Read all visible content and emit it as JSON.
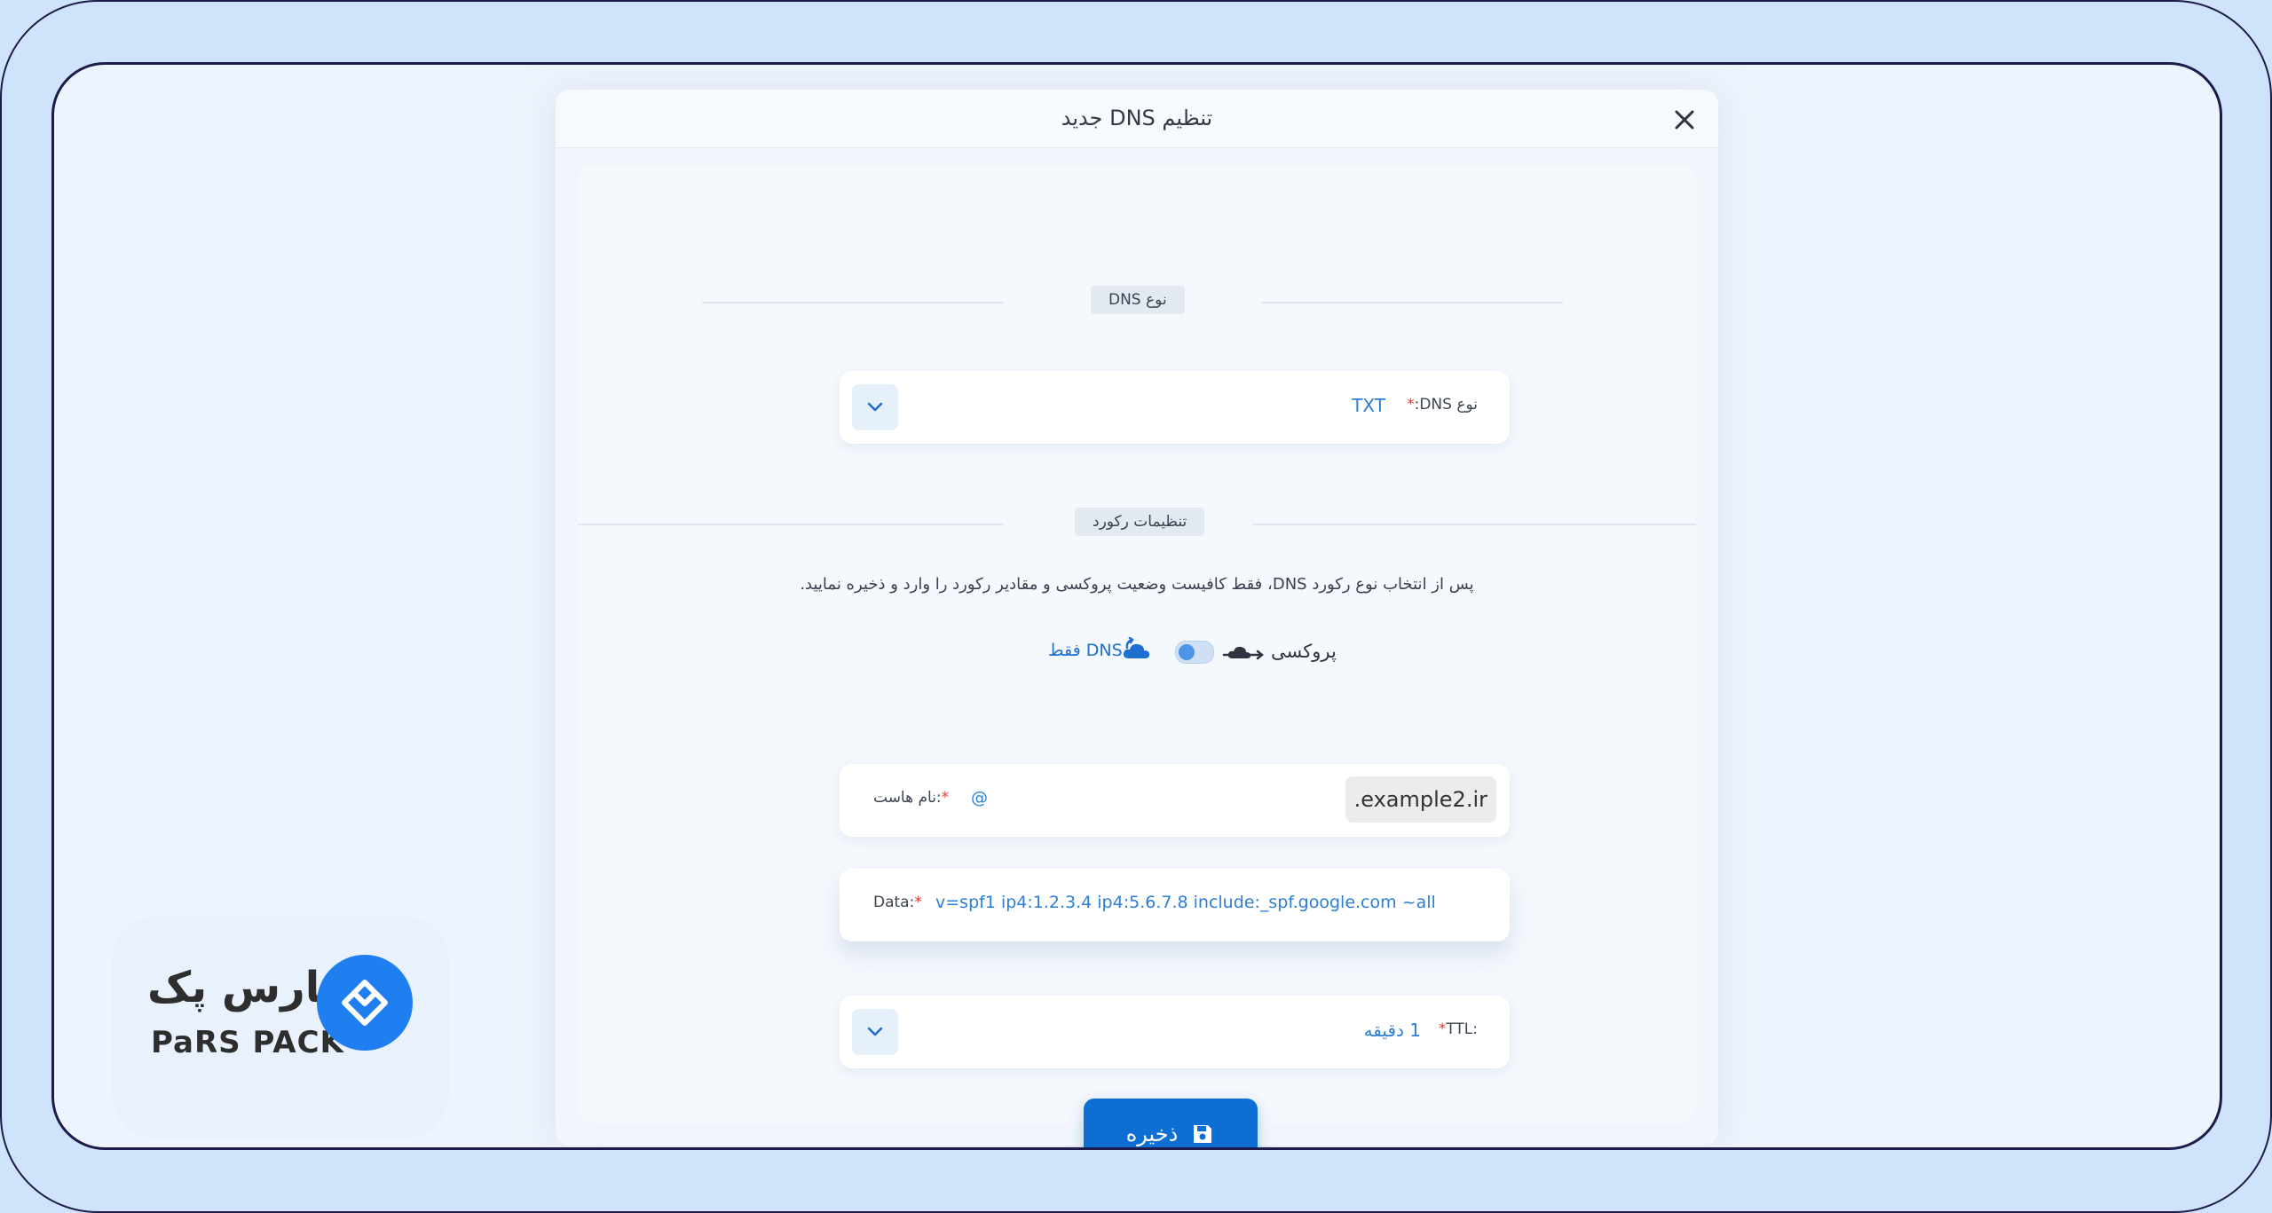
{
  "modal": {
    "title": "تنظیم DNS جدید"
  },
  "sections": {
    "dns_type_title": "نوع DNS",
    "record_settings_title": "تنظیمات رکورد"
  },
  "dns_type": {
    "label": "نوع DNS:",
    "required_mark": "*",
    "value": "TXT"
  },
  "instruction_text": "پس از انتخاب نوع رکورد DNS، فقط کافیست وضعیت پروکسی و مقادیر رکورد را وارد و ذخیره نمایید.",
  "proxy": {
    "proxy_label": "پروکسی",
    "dns_only_label": "DNS فقط",
    "enabled": false
  },
  "host": {
    "label": ":نام هاست",
    "required_mark": "*",
    "value": "@",
    "domain_suffix": ".example2.ir"
  },
  "data_field": {
    "label": "Data:",
    "required_mark": "*",
    "value": "v=spf1 ip4:1.2.3.4 ip4:5.6.7.8 include:_spf.google.com ~all"
  },
  "ttl": {
    "label": "TTL:",
    "required_mark": "*",
    "value": "1 دقیقه"
  },
  "save_label": "ذخیره",
  "logo": {
    "text_fa": "پارس پک",
    "text_en": "PaRS PACK"
  },
  "colors": {
    "accent": "#0d6fd4",
    "link": "#2b7fd7",
    "frame": "#1e1b4b",
    "background": "#cfe3fb"
  }
}
